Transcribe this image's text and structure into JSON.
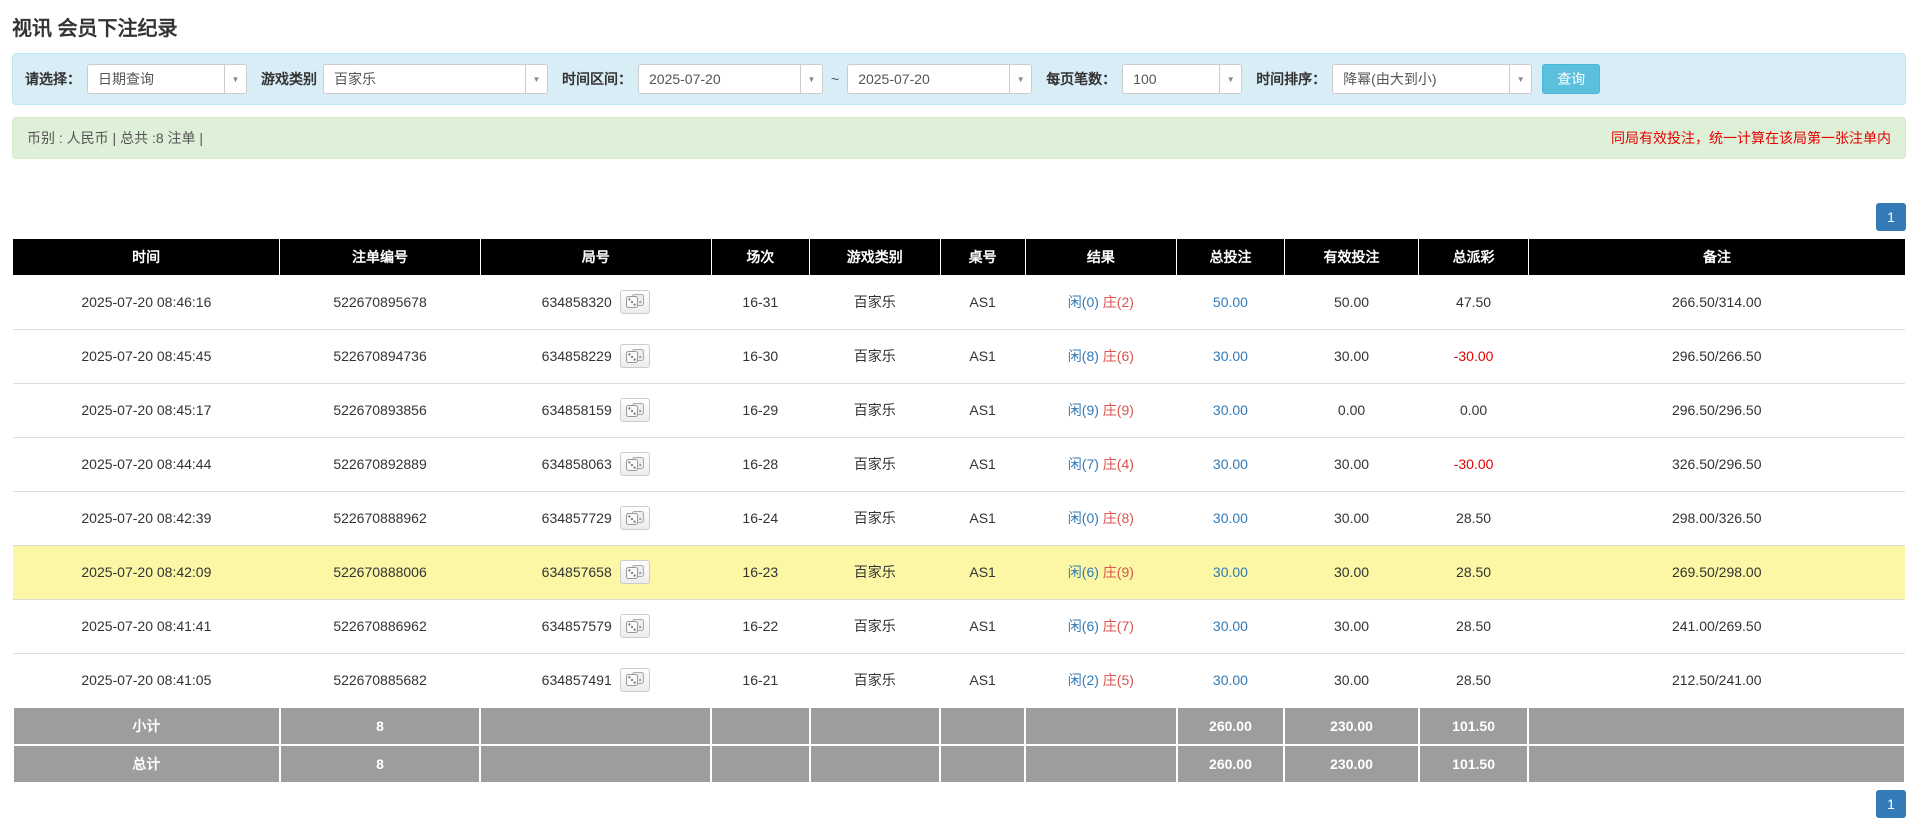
{
  "title": "视讯 会员下注纪录",
  "filters": {
    "select_label": "请选择：",
    "select_value": "日期查询",
    "game_label": "游戏类别",
    "game_value": "百家乐",
    "range_label": "时间区间：",
    "date_from": "2025-07-20",
    "range_separator": "~",
    "date_to": "2025-07-20",
    "page_size_label": "每页笔数：",
    "page_size_value": "100",
    "sort_label": "时间排序：",
    "sort_value": "降幂(由大到小)",
    "search_button": "查询"
  },
  "notice": {
    "left": "币别 : 人民币 | 总共 :8 注单 |",
    "right": "同局有效投注，统一计算在该局第一张注单内"
  },
  "pagination": {
    "top": "1",
    "bottom": "1"
  },
  "table": {
    "headers": [
      "时间",
      "注单编号",
      "局号",
      "场次",
      "游戏类别",
      "桌号",
      "结果",
      "总投注",
      "有效投注",
      "总派彩",
      "备注"
    ],
    "rows": [
      {
        "time": "2025-07-20 08:46:16",
        "bet_id": "522670895678",
        "round_id": "634858320",
        "session": "16-31",
        "game": "百家乐",
        "table_no": "AS1",
        "player": "闲(0)",
        "banker": "庄(2)",
        "total_bet": "50.00",
        "valid_bet": "50.00",
        "payout": "47.50",
        "payout_negative": false,
        "remark": "266.50/314.00",
        "highlight": false
      },
      {
        "time": "2025-07-20 08:45:45",
        "bet_id": "522670894736",
        "round_id": "634858229",
        "session": "16-30",
        "game": "百家乐",
        "table_no": "AS1",
        "player": "闲(8)",
        "banker": "庄(6)",
        "total_bet": "30.00",
        "valid_bet": "30.00",
        "payout": "-30.00",
        "payout_negative": true,
        "remark": "296.50/266.50",
        "highlight": false
      },
      {
        "time": "2025-07-20 08:45:17",
        "bet_id": "522670893856",
        "round_id": "634858159",
        "session": "16-29",
        "game": "百家乐",
        "table_no": "AS1",
        "player": "闲(9)",
        "banker": "庄(9)",
        "total_bet": "30.00",
        "valid_bet": "0.00",
        "payout": "0.00",
        "payout_negative": false,
        "remark": "296.50/296.50",
        "highlight": false
      },
      {
        "time": "2025-07-20 08:44:44",
        "bet_id": "522670892889",
        "round_id": "634858063",
        "session": "16-28",
        "game": "百家乐",
        "table_no": "AS1",
        "player": "闲(7)",
        "banker": "庄(4)",
        "total_bet": "30.00",
        "valid_bet": "30.00",
        "payout": "-30.00",
        "payout_negative": true,
        "remark": "326.50/296.50",
        "highlight": false
      },
      {
        "time": "2025-07-20 08:42:39",
        "bet_id": "522670888962",
        "round_id": "634857729",
        "session": "16-24",
        "game": "百家乐",
        "table_no": "AS1",
        "player": "闲(0)",
        "banker": "庄(8)",
        "total_bet": "30.00",
        "valid_bet": "30.00",
        "payout": "28.50",
        "payout_negative": false,
        "remark": "298.00/326.50",
        "highlight": false
      },
      {
        "time": "2025-07-20 08:42:09",
        "bet_id": "522670888006",
        "round_id": "634857658",
        "session": "16-23",
        "game": "百家乐",
        "table_no": "AS1",
        "player": "闲(6)",
        "banker": "庄(9)",
        "total_bet": "30.00",
        "valid_bet": "30.00",
        "payout": "28.50",
        "payout_negative": false,
        "remark": "269.50/298.00",
        "highlight": true
      },
      {
        "time": "2025-07-20 08:41:41",
        "bet_id": "522670886962",
        "round_id": "634857579",
        "session": "16-22",
        "game": "百家乐",
        "table_no": "AS1",
        "player": "闲(6)",
        "banker": "庄(7)",
        "total_bet": "30.00",
        "valid_bet": "30.00",
        "payout": "28.50",
        "payout_negative": false,
        "remark": "241.00/269.50",
        "highlight": false
      },
      {
        "time": "2025-07-20 08:41:05",
        "bet_id": "522670885682",
        "round_id": "634857491",
        "session": "16-21",
        "game": "百家乐",
        "table_no": "AS1",
        "player": "闲(2)",
        "banker": "庄(5)",
        "total_bet": "30.00",
        "valid_bet": "30.00",
        "payout": "28.50",
        "payout_negative": false,
        "remark": "212.50/241.00",
        "highlight": false
      }
    ],
    "footer": [
      {
        "label": "小计",
        "count": "8",
        "total_bet": "260.00",
        "valid_bet": "230.00",
        "payout": "101.50"
      },
      {
        "label": "总计",
        "count": "8",
        "total_bet": "260.00",
        "valid_bet": "230.00",
        "payout": "101.50"
      }
    ]
  },
  "colors": {
    "player": "#337ab7",
    "banker": "#d9534f",
    "link": "#337ab7",
    "negative": "#e60000",
    "highlight": "#fbf7a5"
  }
}
